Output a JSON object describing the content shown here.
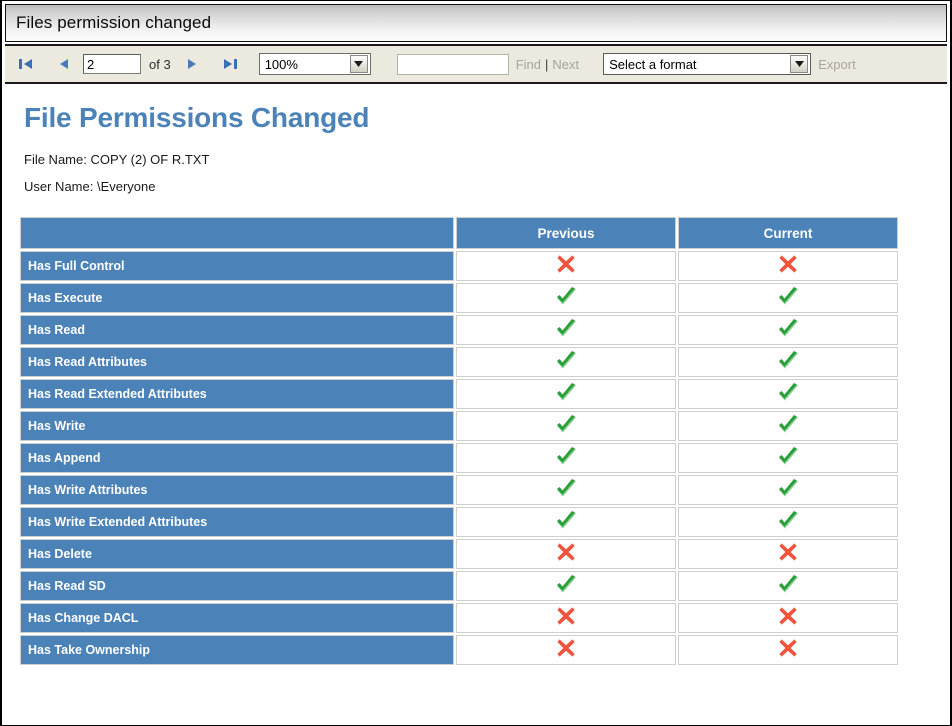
{
  "window": {
    "title": "Files permission changed"
  },
  "toolbar": {
    "first_page_icon": "first-page-icon",
    "prev_page_icon": "previous-page-icon",
    "page_number": "2",
    "of_label": "of 3",
    "next_page_icon": "next-page-icon",
    "last_page_icon": "last-page-icon",
    "zoom_value": "100%",
    "zoom_options": [
      "100%"
    ],
    "find_placeholder": "",
    "find_value": "",
    "find_label": "Find",
    "separator": "|",
    "next_label": "Next",
    "format_value": "Select a format",
    "format_options": [
      "Select a format"
    ],
    "export_label": "Export",
    "dropdown_icon": "chevron-down-icon"
  },
  "report": {
    "title": "File Permissions Changed",
    "file_name_label": "File Name: COPY (2) OF R.TXT",
    "user_name_label": "User Name: \\Everyone",
    "table": {
      "columns": [
        "",
        "Previous",
        "Current"
      ],
      "rows": [
        {
          "label": "Has Full Control",
          "previous": "cross",
          "current": "cross"
        },
        {
          "label": "Has Execute",
          "previous": "check",
          "current": "check"
        },
        {
          "label": "Has Read",
          "previous": "check",
          "current": "check"
        },
        {
          "label": "Has Read Attributes",
          "previous": "check",
          "current": "check"
        },
        {
          "label": "Has Read Extended Attributes",
          "previous": "check",
          "current": "check"
        },
        {
          "label": "Has Write",
          "previous": "check",
          "current": "check"
        },
        {
          "label": "Has Append",
          "previous": "check",
          "current": "check"
        },
        {
          "label": "Has Write Attributes",
          "previous": "check",
          "current": "check"
        },
        {
          "label": "Has Write Extended Attributes",
          "previous": "check",
          "current": "check"
        },
        {
          "label": "Has Delete",
          "previous": "cross",
          "current": "cross"
        },
        {
          "label": "Has Read SD",
          "previous": "check",
          "current": "check"
        },
        {
          "label": "Has Change DACL",
          "previous": "cross",
          "current": "cross"
        },
        {
          "label": "Has Take Ownership",
          "previous": "cross",
          "current": "cross"
        }
      ]
    }
  },
  "colors": {
    "header_blue": "#4b82b8",
    "title_blue": "#4b82b8",
    "check_green": "#2aa038",
    "cross_red": "#f2533a",
    "toolbar_bg": "#ece9df",
    "grid_line": "#cfcfcf"
  }
}
